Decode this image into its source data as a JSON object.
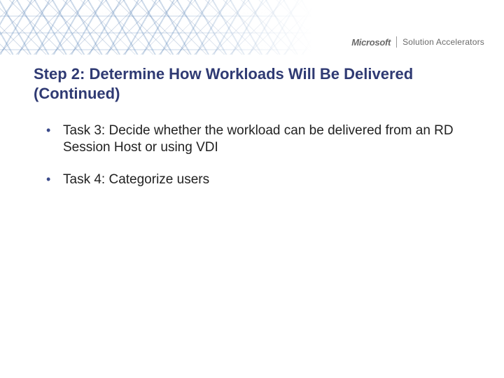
{
  "brand": {
    "company": "Microsoft",
    "product": "Solution Accelerators"
  },
  "title": "Step 2: Determine How Workloads Will Be Delivered (Continued)",
  "bullets": [
    "Task 3: Decide whether the workload can be delivered from an RD Session Host or using VDI",
    "Task 4: Categorize users"
  ]
}
